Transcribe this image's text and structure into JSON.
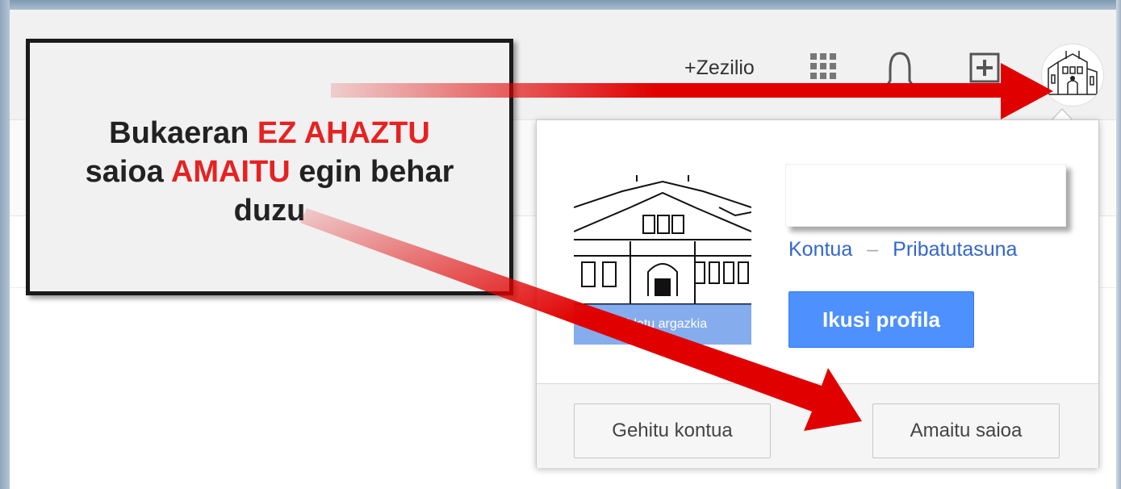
{
  "header": {
    "profile_link": "+Zezilio",
    "icons": [
      "apps-grid-icon",
      "notifications-bell-icon",
      "share-plus-icon",
      "avatar"
    ]
  },
  "account_popup": {
    "change_photo": "Aldatu argazkia",
    "links": {
      "account": "Kontua",
      "separator": "–",
      "privacy": "Pribatutasuna"
    },
    "view_profile": "Ikusi profila",
    "add_account": "Gehitu kontua",
    "sign_out": "Amaitu saioa"
  },
  "callout": {
    "line1_prefix": "Bukaeran ",
    "line1_highlight": "EZ AHAZTU",
    "line2_prefix": "saioa ",
    "line2_highlight": "AMAITU",
    "line2_suffix": " egin behar",
    "line3": "duzu"
  },
  "colors": {
    "accent_blue": "#4d90fe",
    "link_blue": "#3366cc",
    "arrow_red": "#e00000",
    "highlight_red": "#e52222"
  }
}
